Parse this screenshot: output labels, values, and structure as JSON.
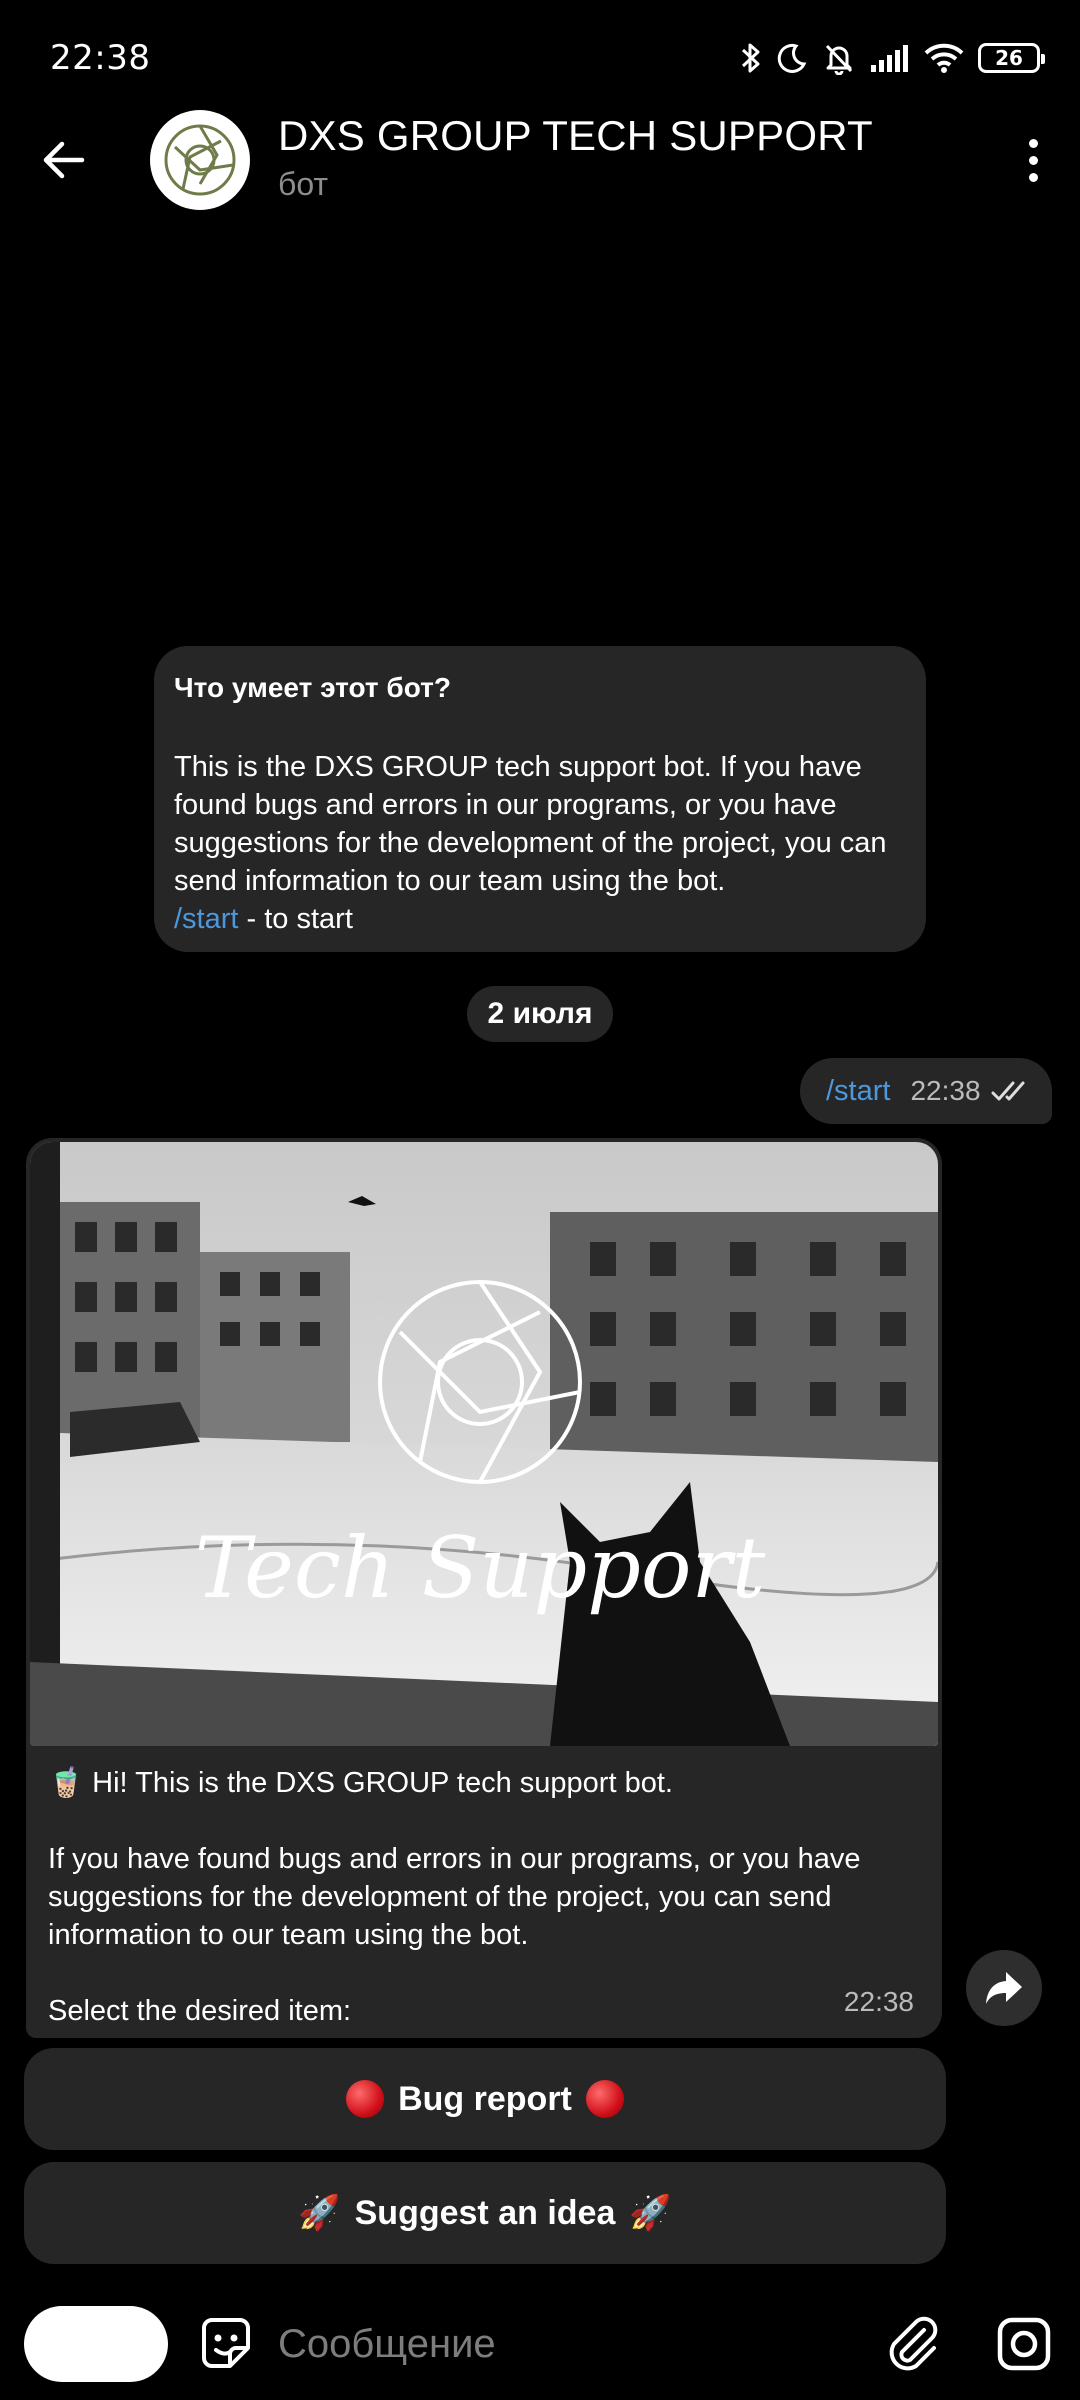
{
  "status_bar": {
    "time": "22:38",
    "battery": "26",
    "icons": [
      "bluetooth-icon",
      "moon-icon",
      "mute-bell-icon",
      "signal-icon",
      "wifi-icon",
      "battery-icon"
    ]
  },
  "header": {
    "title": "DXS GROUP TECH SUPPORT",
    "subtitle": "бот"
  },
  "bot_info": {
    "title": "Что умеет этот бот?",
    "description": "This is the DXS GROUP tech support bot. If you have found bugs and errors in our programs, or you have suggestions for the development of the project, you can send information to our team using the bot.",
    "command": "/start",
    "command_suffix": " - to start"
  },
  "date_separator": "2 июля",
  "outgoing_message": {
    "text": "/start",
    "time": "22:38"
  },
  "incoming_message": {
    "photo_caption": "Tech Support",
    "line1": "🧋 Hi! This is the DXS GROUP tech support bot.",
    "line2": "If you have found bugs and errors in our programs, or you have suggestions for the development of the project, you can send information to our team using the bot.",
    "line3": "Select the desired item:",
    "time": "22:38"
  },
  "keyboard": {
    "bug_report": "Bug report",
    "suggest_idea": "Suggest an idea",
    "rocket_emoji": "🚀"
  },
  "input": {
    "placeholder": "Сообщение"
  },
  "colors": {
    "background": "#000000",
    "bubble": "#262626",
    "link": "#4d98dc",
    "secondary_text": "#8d8d8d"
  }
}
